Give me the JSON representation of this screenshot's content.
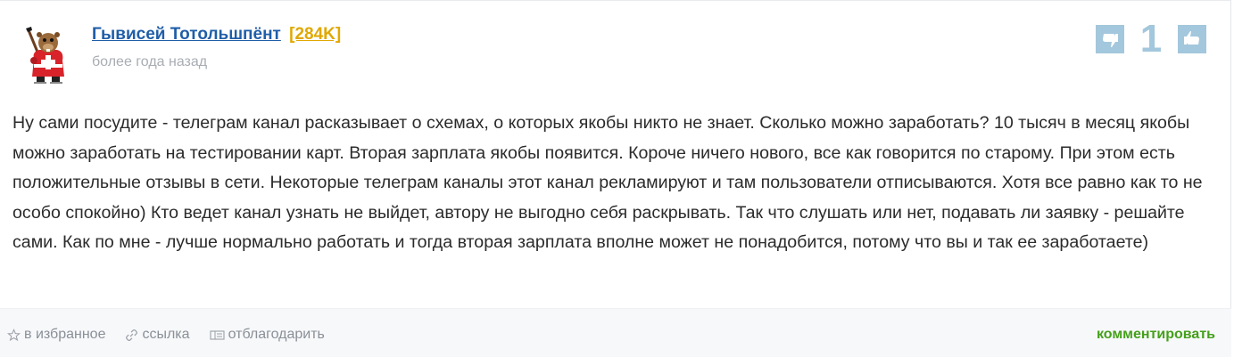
{
  "comment": {
    "author": {
      "name": "Гывисей Тотольшпёнт",
      "rating": "[284K]",
      "avatar": "beaver-hockey-avatar"
    },
    "time": "более года назад",
    "votes": {
      "count": "1",
      "down_icon": "thumbs-down-icon",
      "up_icon": "thumbs-up-icon",
      "color": "#a3c7dc"
    },
    "text": "Ну сами посудите - телеграм канал расказывает о схемах, о которых якобы никто не знает. Сколько можно заработать? 10 тысяч в месяц якобы можно заработать на тестировании карт. Вторая зарплата якобы появится. Короче ничего нового, все как говорится по старому. При этом есть положительные отзывы в сети. Некоторые телеграм каналы этот канал рекламируют и там пользователи отписываются. Хотя все равно как то не особо спокойно) Кто ведет канал узнать не выйдет, автору не выгодно себя раскрывать. Так что слушать или нет, подавать ли заявку - решайте сами. Как по мне - лучше нормально работать и тогда вторая зарплата вполне может не понадобится, потому что вы и так ее заработаете)"
  },
  "footer": {
    "favorite_label": "в избранное",
    "link_label": "ссылка",
    "thank_label": "отблагодарить",
    "comment_label": "комментировать",
    "comment_color": "#44a01a"
  }
}
